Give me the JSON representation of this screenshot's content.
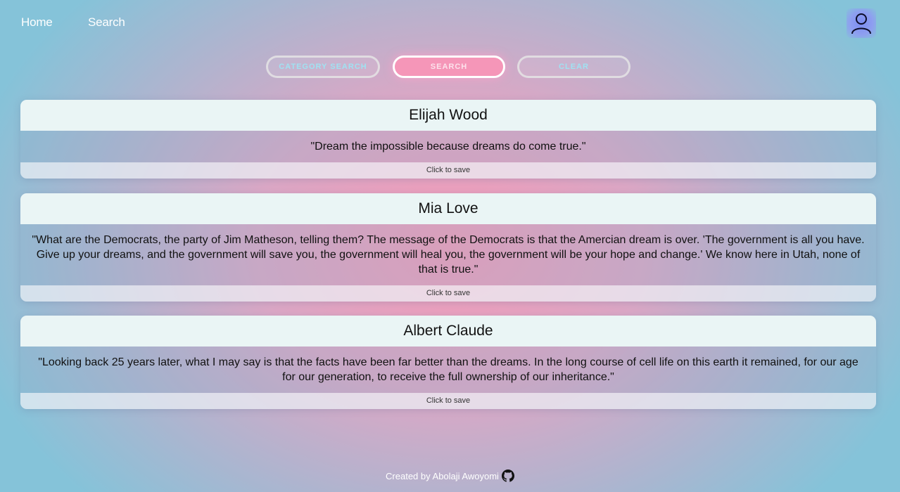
{
  "nav": {
    "home": "Home",
    "search": "Search",
    "avatar_icon": "user-icon"
  },
  "buttons": {
    "category_search": "CATEGORY SEARCH",
    "search": "SEARCH",
    "clear": "CLEAR"
  },
  "quotes": [
    {
      "author": "Elijah Wood",
      "text": "\"Dream the impossible because dreams do come true.\"",
      "save": "Click to save"
    },
    {
      "author": "Mia Love",
      "text": "\"What are the Democrats, the party of Jim Matheson, telling them? The message of the Democrats is that the Amercian dream is over. 'The government is all you have. Give up your dreams, and the government will save you, the government will heal you, the government will be your hope and change.' We know here in Utah, none of that is true.\"",
      "save": "Click to save"
    },
    {
      "author": "Albert Claude",
      "text": "\"Looking back 25 years later, what I may say is that the facts have been far better than the dreams. In the long course of cell life on this earth it remained, for our age for our generation, to receive the full ownership of our inheritance.\"",
      "save": "Click to save"
    }
  ],
  "footer": {
    "text": "Created by Abolaji Awoyomi",
    "icon": "github-icon"
  },
  "colors": {
    "accent_pink": "#f596b8",
    "button_text": "#9fe2f2",
    "card_header": "#eaf5f5"
  }
}
